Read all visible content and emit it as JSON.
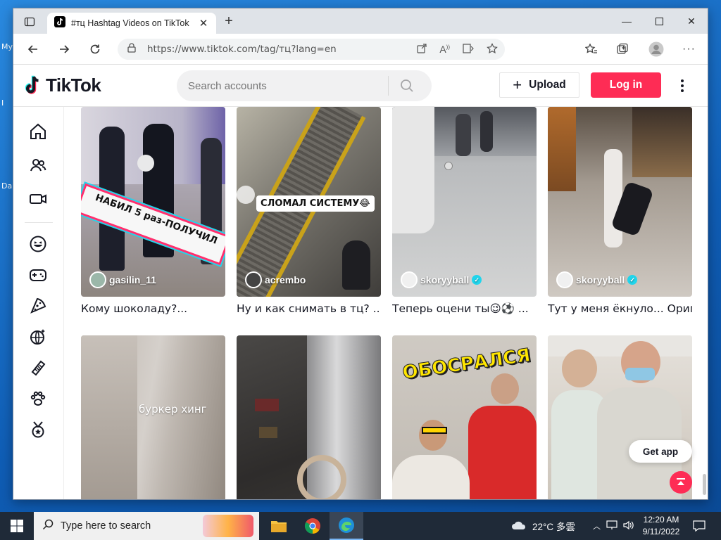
{
  "desktop": {
    "labels": [
      "My",
      "I",
      "Da"
    ]
  },
  "browser": {
    "tab_title": "#тц Hashtag Videos on TikTok",
    "url": "https://www.tiktok.com/tag/тц?lang=en"
  },
  "tiktok": {
    "logo_text": "TikTok",
    "search_placeholder": "Search accounts",
    "upload_label": "Upload",
    "login_label": "Log in",
    "sidebar_icons": [
      "home-icon",
      "following-icon",
      "live-icon",
      "comedy-icon",
      "gaming-icon",
      "food-icon",
      "travel-icon",
      "beauty-icon",
      "animals-icon",
      "sports-icon"
    ]
  },
  "videos": [
    {
      "author": "gasilin_11",
      "verified": false,
      "caption": "Кому шоколаду?...",
      "overlay": "НАБИЛ 5 раз-ПОЛУЧИЛ"
    },
    {
      "author": "acrembo",
      "verified": false,
      "caption": "Ну и как снимать в тц? ...",
      "overlay": "СЛОМАЛ СИСТЕМУ😂"
    },
    {
      "author": "skoryyball",
      "verified": true,
      "caption": "Теперь оцени ты😉⚽ ...",
      "overlay": ""
    },
    {
      "author": "skoryyball",
      "verified": true,
      "caption": "Тут у меня ёкнуло... Ориг...",
      "overlay": ""
    },
    {
      "author": "",
      "verified": false,
      "caption": "",
      "overlay": "буркер хинг"
    },
    {
      "author": "",
      "verified": false,
      "caption": "",
      "overlay": ""
    },
    {
      "author": "",
      "verified": false,
      "caption": "",
      "overlay": "ОБОСРАЛСЯ"
    },
    {
      "author": "",
      "verified": false,
      "caption": "",
      "overlay": ""
    }
  ],
  "get_app_label": "Get app",
  "taskbar": {
    "search_placeholder": "Type here to search",
    "weather": "22°C 多雲",
    "time": "12:20 AM",
    "date": "9/11/2022"
  },
  "colors": {
    "tiktok_red": "#fe2c55",
    "tiktok_cyan": "#20d5ec",
    "taskbar": "#1f2a38"
  }
}
